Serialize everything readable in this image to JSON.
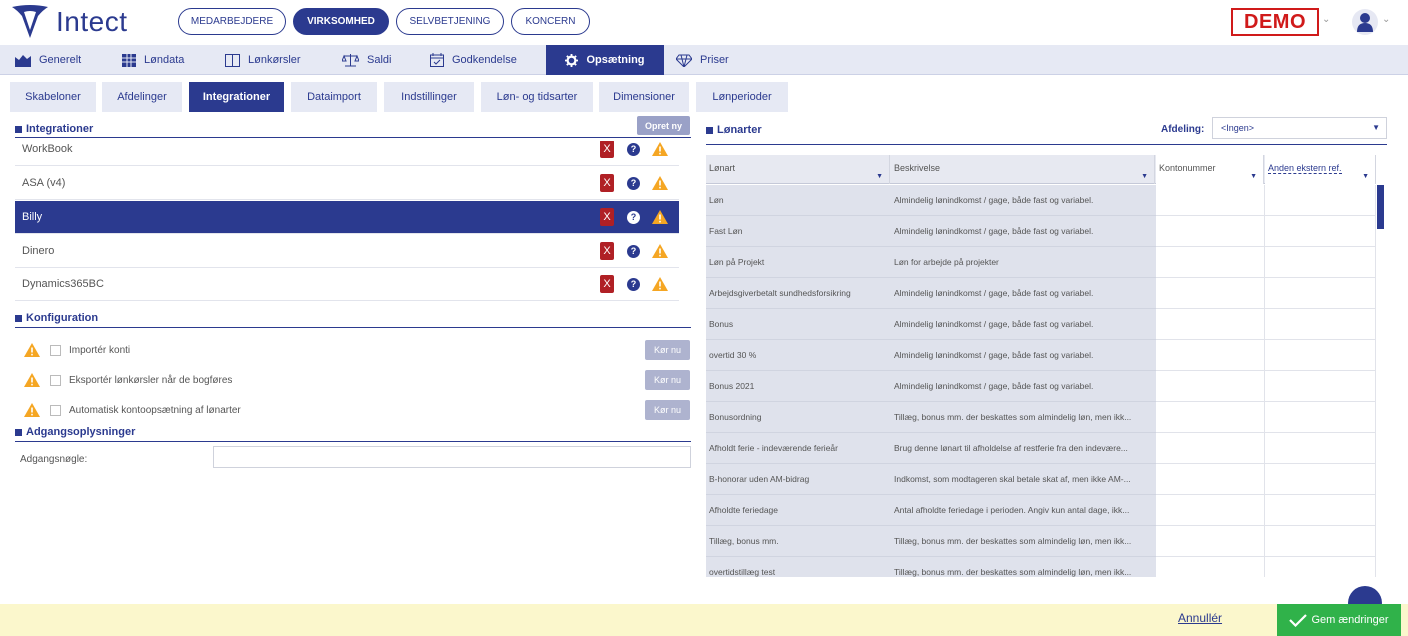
{
  "app": {
    "brand": "Intect",
    "top_tabs": [
      {
        "label": "MEDARBEJDERE"
      },
      {
        "label": "VIRKSOMHED"
      },
      {
        "label": "SELVBETJENING"
      },
      {
        "label": "KONCERN"
      }
    ],
    "env_badge": "DEMO"
  },
  "main_nav": [
    {
      "label": "Generelt",
      "icon": "chart-icon"
    },
    {
      "label": "Løndata",
      "icon": "grid-icon"
    },
    {
      "label": "Lønkørsler",
      "icon": "columns-icon"
    },
    {
      "label": "Saldi",
      "icon": "scale-icon"
    },
    {
      "label": "Godkendelse",
      "icon": "calendar-check-icon"
    },
    {
      "label": "Opsætning",
      "icon": "gear-icon"
    },
    {
      "label": "Priser",
      "icon": "diamond-icon"
    }
  ],
  "sub_tabs": [
    {
      "label": "Skabeloner"
    },
    {
      "label": "Afdelinger"
    },
    {
      "label": "Integrationer"
    },
    {
      "label": "Dataimport"
    },
    {
      "label": "Indstillinger"
    },
    {
      "label": "Løn- og tidsarter"
    },
    {
      "label": "Dimensioner"
    },
    {
      "label": "Lønperioder"
    }
  ],
  "integrations": {
    "title": "Integrationer",
    "new_button": "Opret ny",
    "rows": [
      {
        "name": "WorkBook"
      },
      {
        "name": "ASA (v4)"
      },
      {
        "name": "Billy"
      },
      {
        "name": "Dinero"
      },
      {
        "name": "Dynamics365BC"
      }
    ],
    "delete_glyph": "X",
    "help_glyph": "?"
  },
  "configuration": {
    "title": "Konfiguration",
    "items": [
      {
        "label": "Importér konti",
        "button": "Kør nu"
      },
      {
        "label": "Eksportér lønkørsler når de bogføres",
        "button": "Kør nu"
      },
      {
        "label": "Automatisk kontoopsætning af lønarter",
        "button": "Kør nu"
      }
    ]
  },
  "access": {
    "title": "Adgangsoplysninger",
    "key_label": "Adgangsnøgle:",
    "key_value": ""
  },
  "wage_types": {
    "title": "Lønarter",
    "department_label": "Afdeling:",
    "department_value": "<Ingen>",
    "columns": [
      {
        "label": "Lønart"
      },
      {
        "label": "Beskrivelse"
      },
      {
        "label": "Kontonummer"
      },
      {
        "label": "Anden ekstern ref."
      }
    ],
    "rows": [
      {
        "name": "Løn",
        "desc": "Almindelig lønindkomst / gage, både fast og variabel."
      },
      {
        "name": "Fast Løn",
        "desc": "Almindelig lønindkomst / gage, både fast og variabel."
      },
      {
        "name": "Løn på Projekt",
        "desc": "Løn for arbejde på projekter"
      },
      {
        "name": "Arbejdsgiverbetalt sundhedsforsikring",
        "desc": "Almindelig lønindkomst / gage, både fast og variabel."
      },
      {
        "name": "Bonus",
        "desc": "Almindelig lønindkomst / gage, både fast og variabel."
      },
      {
        "name": "overtid 30 %",
        "desc": "Almindelig lønindkomst / gage, både fast og variabel."
      },
      {
        "name": "Bonus 2021",
        "desc": "Almindelig lønindkomst / gage, både fast og variabel."
      },
      {
        "name": "Bonusordning",
        "desc": "Tillæg, bonus mm. der beskattes som almindelig løn, men ikk..."
      },
      {
        "name": "Afholdt ferie - indeværende ferieår",
        "desc": "Brug denne lønart til afholdelse af restferie fra den indevære..."
      },
      {
        "name": "B-honorar uden AM-bidrag",
        "desc": "Indkomst, som modtageren skal betale skat af, men ikke AM-..."
      },
      {
        "name": "Afholdte feriedage",
        "desc": "Antal afholdte feriedage i perioden. Angiv kun antal dage, ikk..."
      },
      {
        "name": "Tillæg, bonus mm.",
        "desc": "Tillæg, bonus mm. der beskattes som almindelig løn, men ikk..."
      },
      {
        "name": "overtidstillæg test",
        "desc": "Tillæg, bonus mm. der beskattes som almindelig løn, men ikk..."
      }
    ]
  },
  "footer": {
    "cancel": "Annullér",
    "save": "Gem ændringer"
  },
  "colors": {
    "brand": "#2b3a8f",
    "danger": "#b02025",
    "warning": "#f5a623",
    "success": "#30b24a",
    "footer_bg": "#fbf7cc"
  }
}
